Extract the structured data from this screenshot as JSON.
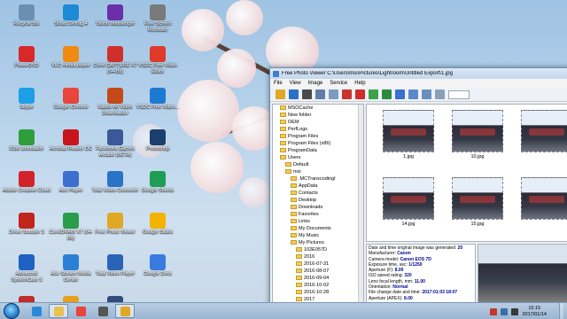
{
  "desktop": {
    "columns": [
      [
        {
          "label": "Recycle Bin",
          "icon": "recycle-bin-icon",
          "color": "#6b8fb0"
        },
        {
          "label": "PowerDVD",
          "icon": "powerdvd-icon",
          "color": "#d8282a"
        },
        {
          "label": "Skype",
          "icon": "skype-icon",
          "color": "#1e9ee6"
        },
        {
          "label": "IObit Uninstaller",
          "icon": "iobit-uninstaller-icon",
          "color": "#2f9e3a"
        },
        {
          "label": "Adobe Creative Cloud",
          "icon": "creative-cloud-icon",
          "color": "#d2232a"
        },
        {
          "label": "Driver Booster 3",
          "icon": "driver-booster-icon",
          "color": "#c0261b"
        },
        {
          "label": "Advanced SystemCare 9",
          "icon": "advanced-systemcare-icon",
          "color": "#1e63c4"
        },
        {
          "label": "Corel PHOTO-PAINT ...",
          "icon": "corel-photopaint-icon",
          "color": "#c12b2b"
        }
      ],
      [
        {
          "label": "Smart Defrag 4",
          "icon": "smart-defrag-icon",
          "color": "#1d8ad6"
        },
        {
          "label": "VLC media player",
          "icon": "vlc-icon",
          "color": "#f08a10"
        },
        {
          "label": "Google Chrome",
          "icon": "chrome-icon",
          "color": "#e8453c"
        },
        {
          "label": "Acrobat Reader DC",
          "icon": "acrobat-reader-icon",
          "color": "#c8151b"
        },
        {
          "label": "Ace Player",
          "icon": "ace-player-icon",
          "color": "#3b6fd0"
        },
        {
          "label": "CorelDRAW X7 (64-Bit)",
          "icon": "coreldraw-icon",
          "color": "#2a9d4a"
        },
        {
          "label": "Ace Stream Media Center",
          "icon": "ace-stream-icon",
          "color": "#2c7fd6"
        },
        {
          "label": "Adobe",
          "icon": "adobe-icon",
          "color": "#e8a020"
        }
      ],
      [
        {
          "label": "Yahoo Messenger",
          "icon": "yahoo-messenger-icon",
          "color": "#6b2fa8"
        },
        {
          "label": "Corel CAPTURE X7 (64-Bit)",
          "icon": "corel-capture-icon",
          "color": "#d0302c"
        },
        {
          "label": "Kastor All Video Downloader",
          "icon": "kastor-icon",
          "color": "#c44a1a"
        },
        {
          "label": "Facebook Games Arcade (BETA)",
          "icon": "facebook-arcade-icon",
          "color": "#3b5998"
        },
        {
          "label": "Total Video Converter",
          "icon": "total-video-converter-icon",
          "color": "#2a74c8"
        },
        {
          "label": "Free Photo Viewer",
          "icon": "free-photo-viewer-icon",
          "color": "#e0a825"
        },
        {
          "label": "Total Video Player",
          "icon": "total-video-player-icon",
          "color": "#2a64b8"
        },
        {
          "label": "Adobe Lightroom",
          "icon": "lightroom-icon",
          "color": "#2f4c7a"
        }
      ],
      [
        {
          "label": "Free Screen Recorder",
          "icon": "screen-recorder-icon",
          "color": "#7a7a7a"
        },
        {
          "label": "VSDC Free Video Editor",
          "icon": "vsdc-editor-icon",
          "color": "#e03a2a"
        },
        {
          "label": "VSDC Free Video...",
          "icon": "vsdc-video-icon",
          "color": "#1e7ad0"
        },
        {
          "label": "Photoshop",
          "icon": "photoshop-icon",
          "color": "#1b3f6e"
        },
        {
          "label": "Google Sheets",
          "icon": "google-sheets-icon",
          "color": "#1f9d55"
        },
        {
          "label": "Google Slides",
          "icon": "google-slides-icon",
          "color": "#f2b400"
        },
        {
          "label": "Google Docs",
          "icon": "google-docs-icon",
          "color": "#3a7be0"
        },
        {
          "label": "",
          "icon": "blank-icon",
          "color": "#00000000"
        }
      ]
    ]
  },
  "window": {
    "title": "Free Photo Viewer C:\\Users\\msi\\Pictures\\Lightroom\\Untitled Export\\1.jpg",
    "menu": [
      "File",
      "View",
      "Image",
      "Service",
      "Help"
    ],
    "toolbar_icons": [
      "open-icon",
      "save-icon",
      "print-icon",
      "copy-icon",
      "paste-icon",
      "cut-icon",
      "delete-icon",
      "rotate-icon",
      "crop-icon",
      "zoom-icon",
      "fullscreen-icon",
      "view-mode-icon",
      "sort-icon"
    ],
    "toolbar_colors": [
      "#e0a825",
      "#2a6fc8",
      "#4a4a4a",
      "#5f7fa8",
      "#7b9bc0",
      "#c8362c",
      "#d22c2c",
      "#3aa34a",
      "#2d8a3e",
      "#3b6fd0",
      "#5a8ac8",
      "#6a8fbf",
      "#8aa0b8"
    ],
    "tree": [
      {
        "label": "MSOCache",
        "indent": 1
      },
      {
        "label": "New folder",
        "indent": 1
      },
      {
        "label": "OEM",
        "indent": 1
      },
      {
        "label": "PerfLogs",
        "indent": 1
      },
      {
        "label": "Program Files",
        "indent": 1
      },
      {
        "label": "Program Files (x86)",
        "indent": 1
      },
      {
        "label": "ProgramData",
        "indent": 1
      },
      {
        "label": "Users",
        "indent": 1
      },
      {
        "label": "Default",
        "indent": 2
      },
      {
        "label": "msi",
        "indent": 2
      },
      {
        "label": ".MCTranscodingI",
        "indent": 3
      },
      {
        "label": "AppData",
        "indent": 3
      },
      {
        "label": "Contacts",
        "indent": 3
      },
      {
        "label": "Desktop",
        "indent": 3
      },
      {
        "label": "Downloads",
        "indent": 3
      },
      {
        "label": "Favorites",
        "indent": 3
      },
      {
        "label": "Links",
        "indent": 3
      },
      {
        "label": "My Documents",
        "indent": 3
      },
      {
        "label": "My Music",
        "indent": 3
      },
      {
        "label": "My Pictures",
        "indent": 3
      },
      {
        "label": "102E057D",
        "indent": 4
      },
      {
        "label": "2016",
        "indent": 4
      },
      {
        "label": "2016-07-31",
        "indent": 4
      },
      {
        "label": "2016-08-07",
        "indent": 4
      },
      {
        "label": "2016-09-04",
        "indent": 4
      },
      {
        "label": "2016-10-02",
        "indent": 4
      },
      {
        "label": "2016-10-28",
        "indent": 4
      },
      {
        "label": "2017",
        "indent": 4
      },
      {
        "label": "campur",
        "indent": 4
      },
      {
        "label": "Lightroom",
        "indent": 4
      }
    ],
    "thumbnails": [
      {
        "caption": "1.jpg",
        "row": 0,
        "col": 0
      },
      {
        "caption": "10.jpg",
        "row": 0,
        "col": 1
      },
      {
        "caption": "",
        "row": 0,
        "col": 2
      },
      {
        "caption": "14.jpg",
        "row": 1,
        "col": 0
      },
      {
        "caption": "15.jpg",
        "row": 1,
        "col": 1
      },
      {
        "caption": "",
        "row": 1,
        "col": 2
      }
    ],
    "info_lines": [
      {
        "k": "Date and time original image was generated:",
        "v": "20"
      },
      {
        "k": "Manufacturer:",
        "v": "Canon"
      },
      {
        "k": "Camera model:",
        "v": "Canon EOS 7D"
      },
      {
        "k": "Exposure time, sec:",
        "v": "1/1250"
      },
      {
        "k": "Aperture (F):",
        "v": "8.00"
      },
      {
        "k": "ISO speed rating:",
        "v": "320"
      },
      {
        "k": "Lens focal length, mm:",
        "v": "11.00"
      },
      {
        "k": "Orientation:",
        "v": "Normal"
      },
      {
        "k": "File change date and time:",
        "v": "2017:01:03 18:07"
      },
      {
        "k": "Aperture (APEX):",
        "v": "8.00"
      }
    ]
  },
  "taskbar": {
    "buttons": [
      {
        "icon": "ie-icon",
        "color": "#2a8ad8",
        "active": false
      },
      {
        "icon": "explorer-icon",
        "color": "#e8c050",
        "active": true
      },
      {
        "icon": "chrome-icon",
        "color": "#e8453c",
        "active": false
      },
      {
        "icon": "camera-app-icon",
        "color": "#555",
        "active": false
      },
      {
        "icon": "photo-viewer-icon",
        "color": "#e0a825",
        "active": true
      }
    ],
    "tray_icons": [
      {
        "icon": "tray-app-icon",
        "color": "#c8362c"
      },
      {
        "icon": "network-icon",
        "color": "#3a6ea8"
      },
      {
        "icon": "volume-icon",
        "color": "#3a3a3a"
      }
    ],
    "time": "15:15",
    "date": "2017/01/14"
  }
}
